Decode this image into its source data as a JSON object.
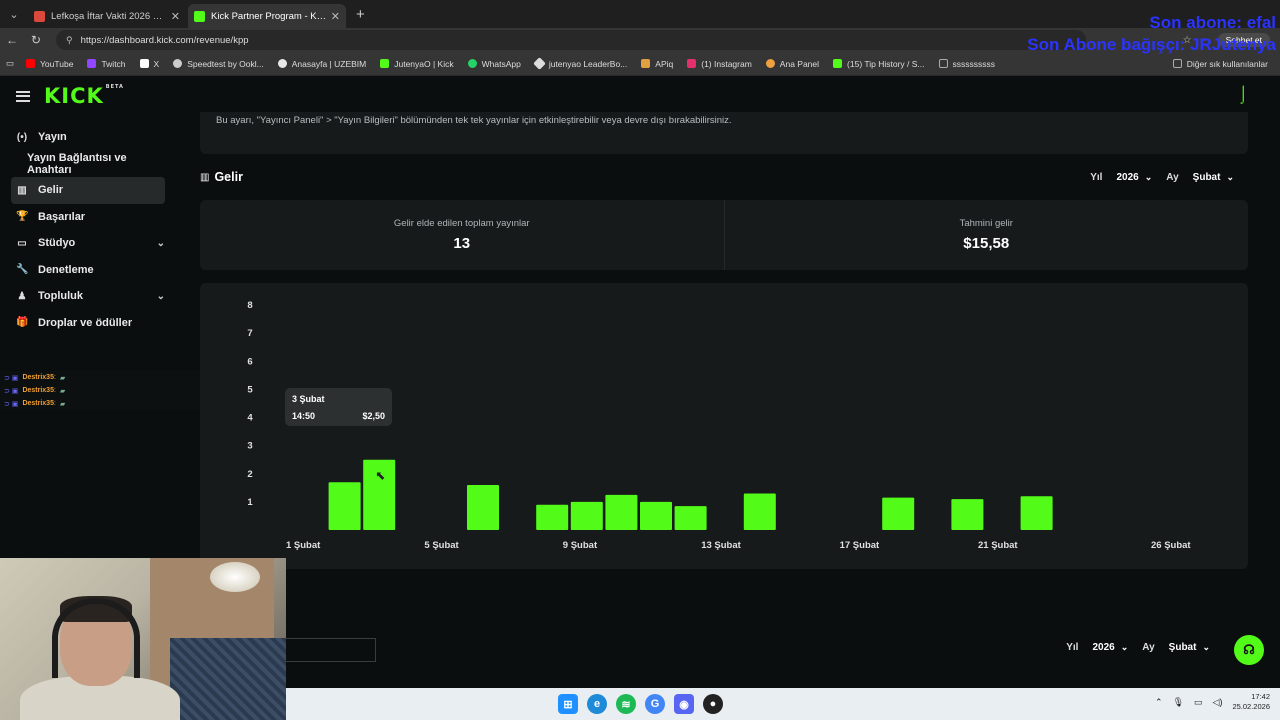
{
  "browser": {
    "tabs": [
      {
        "label": "Lefkoşa İftar Vakti 2026 Lefkoşa İm",
        "favicon_color": "#d94a3d",
        "active": false
      },
      {
        "label": "Kick Partner Program - Kick Dashb",
        "favicon_color": "#53fc18",
        "active": true
      }
    ],
    "url": "https://dashboard.kick.com/revenue/kpp",
    "chat_button": "Sohbet et",
    "bookmarks": [
      {
        "label": "YouTube",
        "color": "#ff0000"
      },
      {
        "label": "Twitch",
        "color": "#9146ff"
      },
      {
        "label": "X",
        "color": "#ffffff"
      },
      {
        "label": "Speedtest by Ookl...",
        "color": "#cccccc"
      },
      {
        "label": "Anasayfa | UZEBIM",
        "color": "#e7e7e7"
      },
      {
        "label": "JutenyaO | Kick",
        "color": "#53fc18"
      },
      {
        "label": "WhatsApp",
        "color": "#25d366"
      },
      {
        "label": "jutenyao LeaderBo...",
        "color": "#dddddd"
      },
      {
        "label": "APiq",
        "color": "#e0a040"
      },
      {
        "label": "(1) Instagram",
        "color": "#e1306c"
      },
      {
        "label": "Ana Panel",
        "color": "#f0a040"
      },
      {
        "label": "(15) Tip History / S...",
        "color": "#53fc18"
      },
      {
        "label": "ssssssssss",
        "color": "#aaaaaa"
      }
    ],
    "bookmarks_other": "Diğer sık kullanılanlar"
  },
  "overlay": {
    "line1": "Son abone: efal",
    "line2": "Son Abone bağışçı: JRJutenya"
  },
  "app": {
    "logo": "KICK",
    "logo_badge": "BETA",
    "sidebar": [
      {
        "label": "Yayın",
        "icon": "broadcast-icon",
        "glyph": "(•)",
        "chevron": false,
        "active": false,
        "sub": false
      },
      {
        "label": "Yayın Bağlantısı ve Anahtarı",
        "icon": "",
        "glyph": "",
        "chevron": false,
        "active": false,
        "sub": true
      },
      {
        "label": "Gelir",
        "icon": "chart-icon",
        "glyph": "▥",
        "chevron": false,
        "active": true,
        "sub": false
      },
      {
        "label": "Başarılar",
        "icon": "trophy-icon",
        "glyph": "🏆",
        "chevron": false,
        "active": false,
        "sub": false
      },
      {
        "label": "Stüdyo",
        "icon": "studio-icon",
        "glyph": "▭",
        "chevron": true,
        "active": false,
        "sub": false
      },
      {
        "label": "Denetleme",
        "icon": "wrench-icon",
        "glyph": "🔧",
        "chevron": false,
        "active": false,
        "sub": false
      },
      {
        "label": "Topluluk",
        "icon": "community-icon",
        "glyph": "♟",
        "chevron": true,
        "active": false,
        "sub": false
      },
      {
        "label": "Droplar ve ödüller",
        "icon": "gift-icon",
        "glyph": "🎁",
        "chevron": false,
        "active": false,
        "sub": false
      }
    ],
    "chat": [
      {
        "user": "Destrix35",
        "sep": ":"
      },
      {
        "user": "Destrix35",
        "sep": ":"
      },
      {
        "user": "Destrix35",
        "sep": ":"
      }
    ],
    "notice": "Bu ayarı, \"Yayıncı Paneli\" > \"Yayın Bilgileri\" bölümünden tek tek yayınlar için etkinleştirebilir veya devre dışı bırakabilirsiniz.",
    "section_title": "Gelir",
    "filters": {
      "year_label": "Yıl",
      "year_value": "2026",
      "month_label": "Ay",
      "month_value": "Şubat"
    },
    "stats": [
      {
        "label": "Gelir elde edilen toplam yayınlar",
        "value": "13"
      },
      {
        "label": "Tahmini gelir",
        "value": "$15,58"
      }
    ],
    "tooltip": {
      "date": "3 Şubat",
      "time": "14:50",
      "amount": "$2,50"
    },
    "bottom_filters": {
      "year_label": "Yıl",
      "year_value": "2026",
      "month_label": "Ay",
      "month_value": "Şubat"
    }
  },
  "chart_data": {
    "type": "bar",
    "title": "",
    "xlabel": "",
    "ylabel": "",
    "bar_color": "#53fc18",
    "ylim": [
      0,
      8
    ],
    "y_ticks": [
      1,
      2,
      3,
      4,
      5,
      6,
      7,
      8
    ],
    "x_ticks": [
      {
        "day": 1,
        "label": "1 Şubat"
      },
      {
        "day": 5,
        "label": "5 Şubat"
      },
      {
        "day": 9,
        "label": "9 Şubat"
      },
      {
        "day": 13,
        "label": "13 Şubat"
      },
      {
        "day": 17,
        "label": "17 Şubat"
      },
      {
        "day": 21,
        "label": "21 Şubat"
      },
      {
        "day": 26,
        "label": "26 Şubat"
      }
    ],
    "days": [
      2,
      3,
      6,
      8,
      9,
      10,
      11,
      12,
      14,
      18,
      20,
      22
    ],
    "values": [
      1.7,
      2.5,
      1.6,
      0.9,
      1.0,
      1.25,
      1.0,
      0.85,
      1.3,
      1.15,
      1.1,
      1.2
    ]
  },
  "taskbar": {
    "clock_time": "17:42",
    "clock_date": "25.02.2026"
  }
}
